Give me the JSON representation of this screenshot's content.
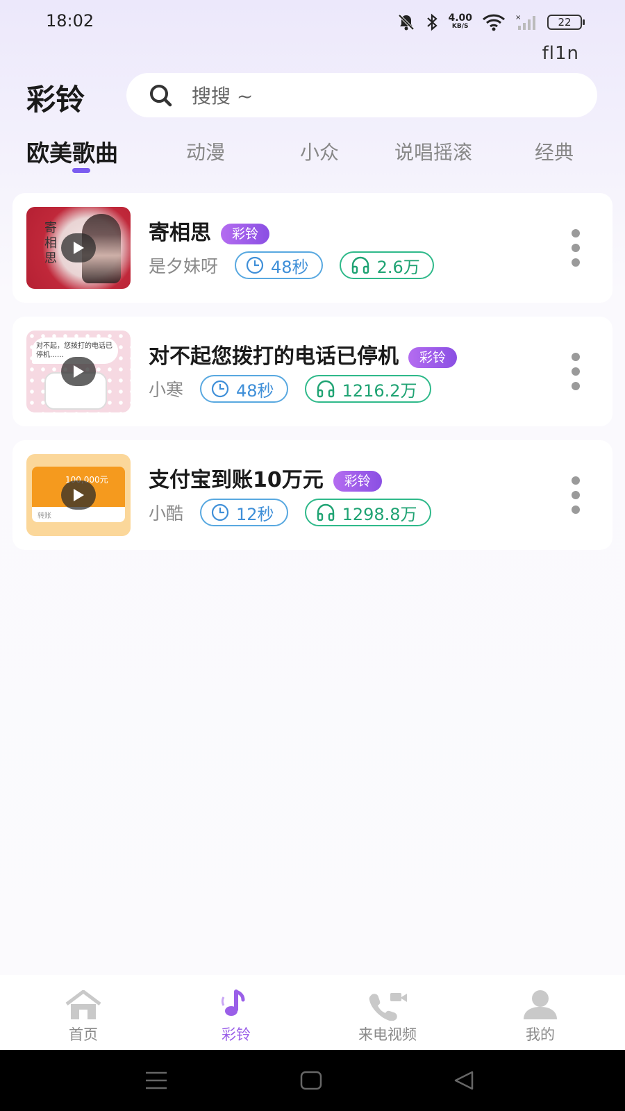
{
  "status_bar": {
    "time": "18:02",
    "net_speed": "4.00",
    "net_unit": "KB/S",
    "battery": "22"
  },
  "corner_mark": "fl1n",
  "header": {
    "title": "彩铃",
    "search_placeholder": "搜搜 ~"
  },
  "tabs": [
    {
      "label": "欧美歌曲",
      "active": true
    },
    {
      "label": "动漫"
    },
    {
      "label": "小众"
    },
    {
      "label": "说唱摇滚"
    },
    {
      "label": "经典"
    }
  ],
  "songs": [
    {
      "title": "寄相思",
      "tag": "彩铃",
      "artist": "是夕妹呀",
      "duration": "48秒",
      "plays": "2.6万",
      "thumb_text": "寄相思"
    },
    {
      "title": "对不起您拨打的电话已停机",
      "tag": "彩铃",
      "artist": "小寒",
      "duration": "48秒",
      "plays": "1216.2万",
      "thumb_text": "对不起，您拨打的电话已停机……"
    },
    {
      "title": "支付宝到账10万元",
      "tag": "彩铃",
      "artist": "小酷",
      "duration": "12秒",
      "plays": "1298.8万",
      "thumb_text": "100,000元",
      "thumb_text_2": "转账"
    }
  ],
  "bottom_nav": [
    {
      "label": "首页",
      "icon": "home-icon"
    },
    {
      "label": "彩铃",
      "icon": "music-note-icon",
      "active": true
    },
    {
      "label": "来电视频",
      "icon": "phone-video-icon"
    },
    {
      "label": "我的",
      "icon": "user-icon"
    }
  ],
  "colors": {
    "accent": "#7b5cf0",
    "tag_gradient_start": "#b46cf0",
    "duration_blue": "#3f8fd8",
    "plays_green": "#1fa373"
  }
}
